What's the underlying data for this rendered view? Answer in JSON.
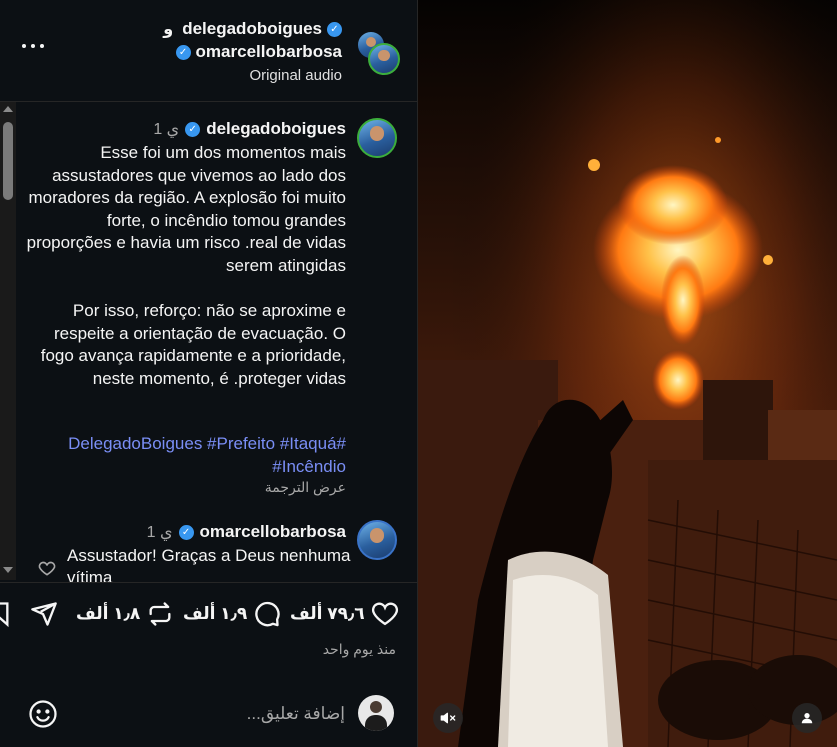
{
  "header": {
    "user1": "delegadoboigues",
    "and_word": "و",
    "user2": "omarcellobarbosa",
    "audio": "Original audio"
  },
  "caption": {
    "username": "delegadoboigues",
    "time": "1 ي",
    "text": "Esse foi um dos momentos mais assustadores que vivemos ao lado dos moradores da região. A explosão foi muito forte, o incêndio tomou grandes proporções e havia um risco .real de vidas serem atingidas\n\nPor isso, reforço: não se aproxime e respeite a orientação de evacuação. O fogo avança rapidamente e a prioridade, neste momento, é .proteger vidas",
    "hashtags": "DelegadoBoigues #Prefeito #Itaquá# #Incêndio",
    "translate": "عرض الترجمة"
  },
  "comment": {
    "username": "omarcellobarbosa",
    "time": "1 ي",
    "text": "Assustador! Graças a Deus nenhuma vítima"
  },
  "actions": {
    "likes": "٧٩٫٦ ألف",
    "comments": "١٫٩ ألف",
    "reposts": "١٫٨ ألف",
    "date": "منذ يوم واحد"
  },
  "compose": {
    "placeholder": "إضافة تعليق..."
  },
  "colors": {
    "panel_bg": "#0c1014",
    "verified": "#3897f0",
    "hashtag": "#7a8ef5",
    "fire": "#ff8a1c"
  },
  "icons": [
    "more-icon",
    "verified-icon",
    "heart-icon",
    "comment-icon",
    "repost-icon",
    "share-icon",
    "bookmark-icon",
    "emoji-icon",
    "mute-icon",
    "user-tag-icon"
  ]
}
